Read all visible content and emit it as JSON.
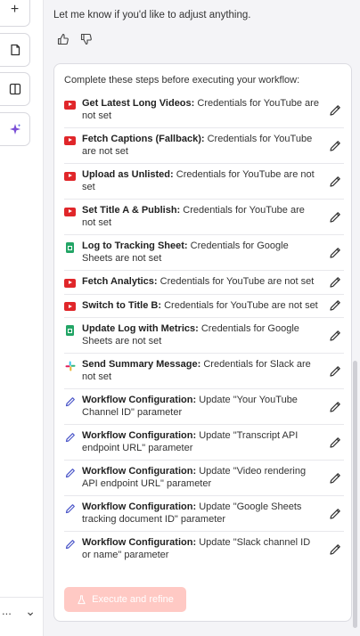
{
  "rail": {
    "buttons": [
      {
        "icon": "plus-icon",
        "glyph": "+"
      },
      {
        "icon": "note-icon"
      },
      {
        "icon": "panel-icon"
      },
      {
        "icon": "sparkle-icon"
      }
    ],
    "bottom_more": "...",
    "bottom_chevron": "⌄"
  },
  "chat": {
    "message": "Let me know if you'd like to adjust anything."
  },
  "checklist": {
    "title": "Complete these steps before executing your workflow:",
    "steps": [
      {
        "icon": "youtube-icon",
        "name": "Get Latest Long Videos:",
        "text": "Credentials for YouTube are not set"
      },
      {
        "icon": "youtube-icon",
        "name": "Fetch Captions (Fallback):",
        "text": "Credentials for YouTube are not set"
      },
      {
        "icon": "youtube-icon",
        "name": "Upload as Unlisted:",
        "text": "Credentials for YouTube are not set"
      },
      {
        "icon": "youtube-icon",
        "name": "Set Title A & Publish:",
        "text": "Credentials for YouTube are not set"
      },
      {
        "icon": "google-sheets-icon",
        "name": "Log to Tracking Sheet:",
        "text": "Credentials for Google Sheets are not set"
      },
      {
        "icon": "youtube-icon",
        "name": "Fetch Analytics:",
        "text": "Credentials for YouTube are not set"
      },
      {
        "icon": "youtube-icon",
        "name": "Switch to Title B:",
        "text": "Credentials for YouTube are not set"
      },
      {
        "icon": "google-sheets-icon",
        "name": "Update Log with Metrics:",
        "text": "Credentials for Google Sheets are not set"
      },
      {
        "icon": "slack-icon",
        "name": "Send Summary Message:",
        "text": "Credentials for Slack are not set"
      },
      {
        "icon": "pencil-config-icon",
        "name": "Workflow Configuration:",
        "text": "Update \"Your YouTube Channel ID\" parameter"
      },
      {
        "icon": "pencil-config-icon",
        "name": "Workflow Configuration:",
        "text": "Update \"Transcript API endpoint URL\" parameter"
      },
      {
        "icon": "pencil-config-icon",
        "name": "Workflow Configuration:",
        "text": "Update \"Video rendering API endpoint URL\" parameter"
      },
      {
        "icon": "pencil-config-icon",
        "name": "Workflow Configuration:",
        "text": "Update \"Google Sheets tracking document ID\" parameter"
      },
      {
        "icon": "pencil-config-icon",
        "name": "Workflow Configuration:",
        "text": "Update \"Slack channel ID or name\" parameter"
      }
    ],
    "execute_label": "Execute and refine"
  },
  "colors": {
    "youtube": "#e0262a",
    "sheets": "#23a566",
    "config_pencil": "#4a55c8",
    "execute_disabled": "#ffc9c4"
  }
}
